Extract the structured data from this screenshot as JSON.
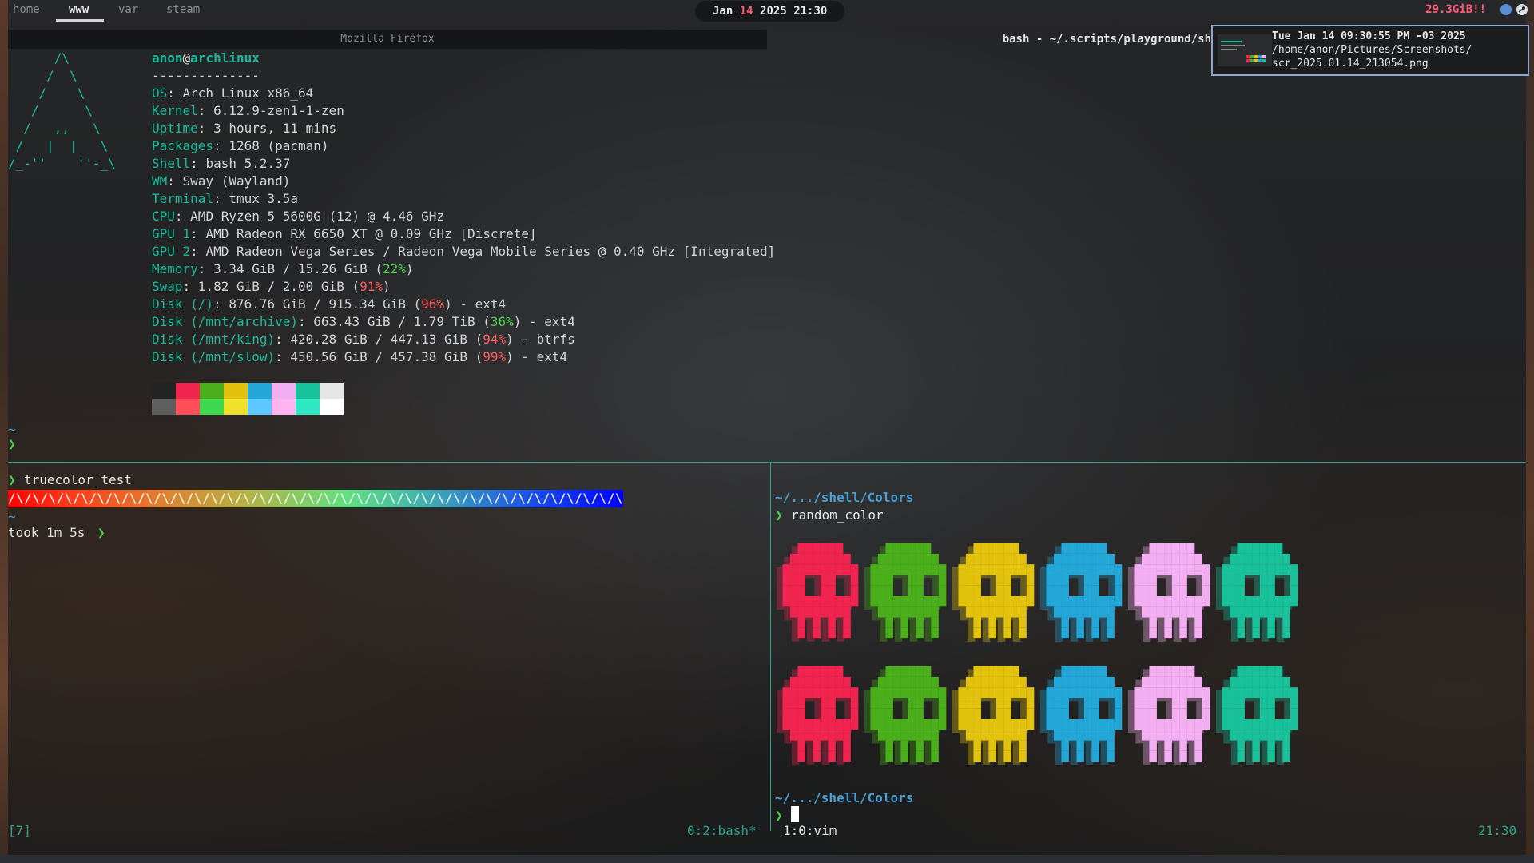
{
  "topbar": {
    "workspaces": [
      "home",
      "www",
      "var",
      "steam"
    ],
    "active_workspace": "www",
    "clock": {
      "month": "Jan",
      "day": "14",
      "year": "2025",
      "time": "21:30"
    },
    "memory_warning": "29.3GiB!!",
    "tray_icons": [
      "network-icon",
      "steam-icon"
    ]
  },
  "windows": {
    "firefox_title": "Mozilla Firefox",
    "bash_title": "bash - ~/.scripts/playground/sh"
  },
  "notification": {
    "title": "Tue Jan 14 09:30:55 PM -03 2025",
    "line1": "/home/anon/Pictures/Screenshots/",
    "line2": "scr_2025.01.14_213054.png"
  },
  "fastfetch": {
    "user": "anon",
    "host": "archlinux",
    "separator": "--------------",
    "os_key": "OS",
    "os": "Arch Linux x86_64",
    "kernel_key": "Kernel",
    "kernel": "6.12.9-zen1-1-zen",
    "uptime_key": "Uptime",
    "uptime": "3 hours, 11 mins",
    "packages_key": "Packages",
    "packages": "1268 (pacman)",
    "shell_key": "Shell",
    "shell": "bash 5.2.37",
    "wm_key": "WM",
    "wm": "Sway (Wayland)",
    "terminal_key": "Terminal",
    "terminal": "tmux 3.5a",
    "cpu_key": "CPU",
    "cpu": "AMD Ryzen 5 5600G (12) @ 4.46 GHz",
    "gpu1_key": "GPU 1",
    "gpu1": "AMD Radeon RX 6650 XT @ 0.09 GHz [Discrete]",
    "gpu2_key": "GPU 2",
    "gpu2": "AMD Radeon Vega Series / Radeon Vega Mobile Series @ 0.40 GHz [Integrated]",
    "memory_key": "Memory",
    "memory_pre": "3.34 GiB / 15.26 GiB (",
    "memory_pct": "22%",
    "memory_post": ")",
    "swap_key": "Swap",
    "swap_pre": "1.82 GiB / 2.00 GiB (",
    "swap_pct": "91%",
    "swap_post": ")",
    "disks": [
      {
        "key": "Disk (/)",
        "pre": "876.76 GiB / 915.34 GiB (",
        "pct": "96%",
        "post": ") - ext4",
        "level": "red"
      },
      {
        "key": "Disk (/mnt/archive)",
        "pre": "663.43 GiB / 1.79 TiB (",
        "pct": "36%",
        "post": ") - ext4",
        "level": "green"
      },
      {
        "key": "Disk (/mnt/king)",
        "pre": "420.28 GiB / 447.13 GiB (",
        "pct": "94%",
        "post": ") - btrfs",
        "level": "red"
      },
      {
        "key": "Disk (/mnt/slow)",
        "pre": "450.56 GiB / 457.38 GiB (",
        "pct": "99%",
        "post": ") - ext4",
        "level": "red"
      }
    ],
    "palette_dark": [
      "#232323",
      "#f0244f",
      "#4aaf1a",
      "#e2c20c",
      "#22a7d8",
      "#f3aef2",
      "#19c19a",
      "#e6e6e6"
    ],
    "palette_bright": [
      "#5e5e5e",
      "#ff4d5a",
      "#3fd94f",
      "#f0e02a",
      "#5fc7ff",
      "#ffb4f0",
      "#2fe6c2",
      "#ffffff"
    ]
  },
  "left_pane": {
    "prompt_tilde": "~",
    "prompt_chev": "❯",
    "command": "truecolor_test",
    "bar_text": "/\\/\\/\\/\\/\\/\\/\\/\\/\\/\\/\\/\\/\\/\\/\\/\\/\\/\\/\\/\\/\\/\\/\\/\\/\\/\\/\\/\\/\\/\\/\\/\\/\\/\\/\\/\\/\\/\\/",
    "took": "took 1m 5s"
  },
  "right_pane": {
    "path": "~/.../shell/Colors",
    "command": "random_color",
    "skull_colors": [
      "#f0244f",
      "#4aaf1a",
      "#e2c20c",
      "#22a7d8",
      "#f3aef2",
      "#19c19a"
    ]
  },
  "statusline": {
    "session": "[7]",
    "window0": "0:2:bash*",
    "window1": "1:0:vim",
    "time": "21:30"
  }
}
